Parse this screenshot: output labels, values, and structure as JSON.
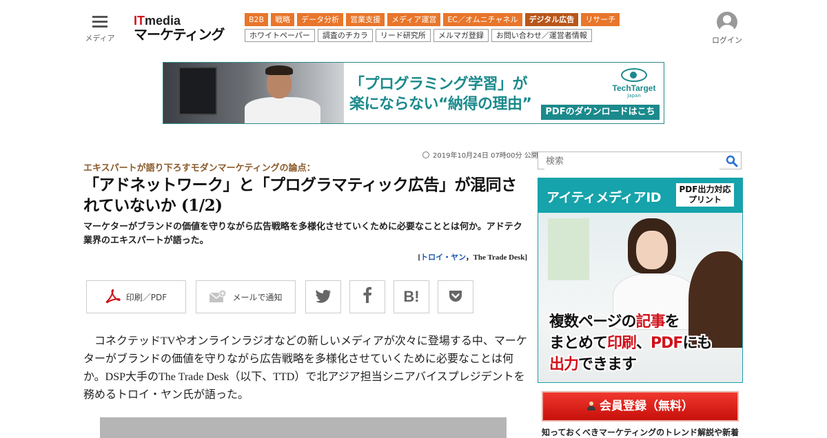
{
  "header": {
    "menu_label": "メディア",
    "logo_it_red": "IT",
    "logo_it_rest": "media",
    "logo_main": "マーケティング",
    "categories": [
      "B2B",
      "戦略",
      "データ分析",
      "営業支援",
      "メディア運営",
      "EC／オムニチャネル",
      "デジタル広告",
      "リサーチ"
    ],
    "active_category": "デジタル広告",
    "sub_links": [
      "ホワイトペーパー",
      "調査のチカラ",
      "リード研究所",
      "メルマガ登録",
      "お問い合わせ／運営者情報"
    ],
    "login_label": "ログイン"
  },
  "banner": {
    "headline_line1": "「プログラミング学習」が",
    "headline_line2": "楽にならない“納得の理由”",
    "brand_name": "TechTarget",
    "brand_sub": "Japan",
    "cta": "PDFのダウンロードはこちら"
  },
  "article": {
    "date": "2019年10月24日 07時00分 公開",
    "series": "エキスパートが語り下ろすモダンマーケティングの論点：",
    "title": "「アドネットワーク」と「プログラマティック広告」が混同されていないか (1/2)",
    "lead": "マーケターがブランドの価値を守りながら広告戦略を多様化させていくために必要なこととは何か。アドテク業界のエキスパートが語った。",
    "author_name": "トロイ・ヤン",
    "author_org": "The Trade Desk",
    "share": {
      "print_label": "印刷／PDF",
      "mail_label": "メールで通知",
      "hatena_label": "B!"
    },
    "body": "コネクテッドTVやオンラインラジオなどの新しいメディアが次々に登場する中、マーケターがブランドの価値を守りながら広告戦略を多様化させていくために必要なことは何か。DSP大手のThe Trade Desk（以下、TTD）で北アジア担当シニアバイスプレジデントを務めるトロイ・ヤン氏が語った。"
  },
  "sidebar": {
    "search_placeholder": "検索",
    "ad": {
      "title": "アイティメディアID",
      "box_line1": "PDF出力対応",
      "box_line2": "プリント",
      "text_line1_a": "複数ページの",
      "text_line1_b": "記事",
      "text_line1_c": "を",
      "text_line2_a": "まとめて",
      "text_line2_b": "印刷",
      "text_line2_c": "、",
      "text_line2_d": "PDF",
      "text_line2_e": "にも",
      "text_line3_a": "出力",
      "text_line3_b": "できます"
    },
    "register_label": "会員登録（無料）",
    "caption": "知っておくべきマーケティングのトレンド解説や新着"
  },
  "colors": {
    "category_orange": "#e8762b",
    "category_active": "#b8561a",
    "teal": "#1b8a8c",
    "register_red": "#d0121b",
    "author_link": "#1a56b0"
  }
}
